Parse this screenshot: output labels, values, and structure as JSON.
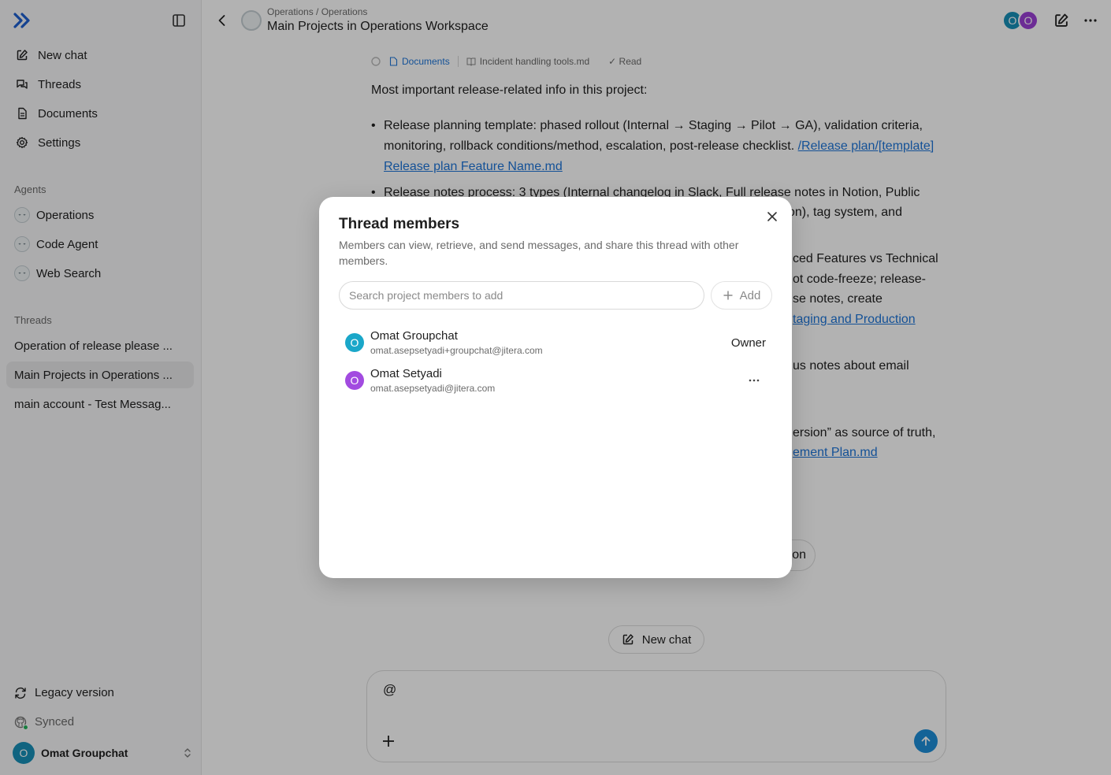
{
  "sidebar": {
    "nav": [
      {
        "label": "New chat",
        "icon": "edit-icon"
      },
      {
        "label": "Threads",
        "icon": "threads-icon"
      },
      {
        "label": "Documents",
        "icon": "document-icon"
      },
      {
        "label": "Settings",
        "icon": "gear-icon"
      }
    ],
    "agents_label": "Agents",
    "agents": [
      "Operations",
      "Code Agent",
      "Web Search"
    ],
    "threads_label": "Threads",
    "threads": [
      "Operation of release please ...",
      "Main Projects in Operations ...",
      "main account - Test Messag..."
    ],
    "legacy_label": "Legacy version",
    "synced_label": "Synced",
    "user": {
      "initial": "O",
      "name": "Omat Groupchat"
    }
  },
  "header": {
    "breadcrumb": "Operations / Operations",
    "title": "Main Projects in Operations Workspace",
    "avatars": [
      {
        "initial": "O",
        "color": "#1890b8"
      },
      {
        "initial": "O",
        "color": "#9b3fd6"
      }
    ]
  },
  "content": {
    "chips": {
      "documents": "Documents",
      "file": "Incident handling tools.md",
      "status": "✓ Read"
    },
    "intro": "Most important release-related info in this project:",
    "bullet1_text": "Release planning template: phased rollout (Internal → Staging → Pilot → GA), validation criteria, monitoring, rollback conditions/method, escalation, post-release checklist.",
    "bullet1_link": "/Release plan/[template] Release plan Feature Name.md",
    "bullet2_text": "Release notes process: 3 types (Internal changelog in Slack, Full release notes in Notion, Public",
    "frag_bullet2_tail": "on), tag system, and",
    "frag_b3_line1": "ced Features vs Technical",
    "frag_b3_line2": "ot code-freeze; release-",
    "frag_b3_line3": "se notes, create",
    "frag_b3_link": "taging and Production",
    "frag_b4": "us notes about email",
    "frag_b5": "ersion” as source of truth,",
    "frag_b5_link": "ement Plan.md",
    "pill_fragment": "on",
    "new_chat_label": "New chat",
    "composer_value": "@"
  },
  "modal": {
    "title": "Thread members",
    "description": "Members can view, retrieve, and send messages, and share this thread with other members.",
    "search_placeholder": "Search project members to add",
    "add_label": "Add",
    "members": [
      {
        "initial": "O",
        "name": "Omat Groupchat",
        "email": "omat.asepsetyadi+groupchat@jitera.com",
        "role": "Owner",
        "color": "#1aa7c9"
      },
      {
        "initial": "O",
        "name": "Omat Setyadi",
        "email": "omat.asepsetyadi@jitera.com",
        "role": "",
        "color": "#a24be0"
      }
    ]
  },
  "colors": {
    "accent": "#1d75d8",
    "send_button": "#1e8fd8",
    "overlay": "rgba(0,0,0,0.30)"
  }
}
